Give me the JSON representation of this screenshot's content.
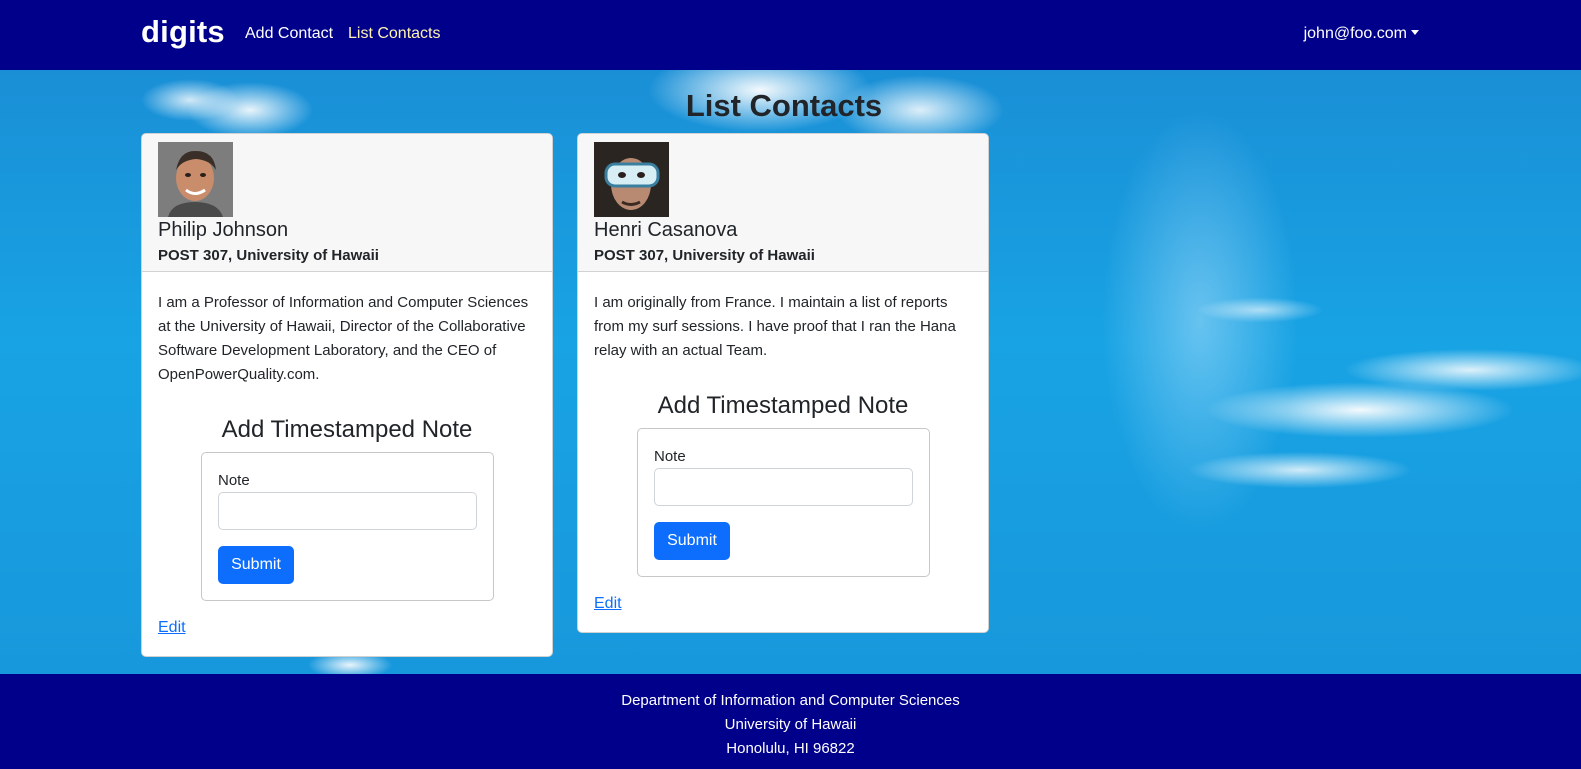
{
  "navbar": {
    "brand": "digits",
    "links": [
      {
        "label": "Add Contact"
      },
      {
        "label": "List Contacts"
      }
    ],
    "user": "john@foo.com"
  },
  "page": {
    "title": "List Contacts"
  },
  "contacts": [
    {
      "name": "Philip Johnson",
      "address": "POST 307, University of Hawaii",
      "description": "I am a Professor of Information and Computer Sciences at the University of Hawaii, Director of the Collaborative Software Development Laboratory, and the CEO of OpenPowerQuality.com.",
      "note_title": "Add Timestamped Note",
      "note_label": "Note",
      "note_value": "",
      "submit_label": "Submit",
      "edit_label": "Edit"
    },
    {
      "name": "Henri Casanova",
      "address": "POST 307, University of Hawaii",
      "description": "I am originally from France. I maintain a list of reports from my surf sessions. I have proof that I ran the Hana relay with an actual Team.",
      "note_title": "Add Timestamped Note",
      "note_label": "Note",
      "note_value": "",
      "submit_label": "Submit",
      "edit_label": "Edit"
    }
  ],
  "footer": {
    "line1": "Department of Information and Computer Sciences",
    "line2": "University of Hawaii",
    "line3": "Honolulu, HI 96822"
  },
  "colors": {
    "navbar": "#00008b",
    "active_link": "#fff3b0",
    "primary": "#0d6efd"
  }
}
